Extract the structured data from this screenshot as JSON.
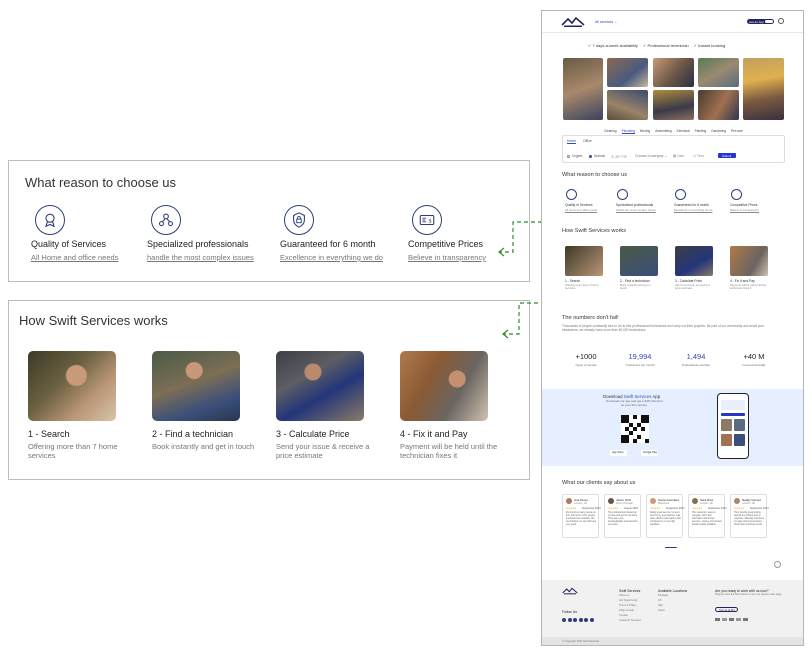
{
  "zoom_reasons": {
    "title": "What reason to choose us",
    "items": [
      {
        "title": "Quality of Services",
        "subtitle": "All Home and office needs",
        "icon": "quality-badge-icon"
      },
      {
        "title": "Specialized professionals",
        "subtitle": "handle the most complex issues",
        "icon": "professional-network-icon"
      },
      {
        "title": "Guaranteed for 6 month",
        "subtitle": "Excellence in everything we do",
        "icon": "guarantee-shield-icon"
      },
      {
        "title": "Competitive Prices",
        "subtitle": "Believe in transparency",
        "icon": "price-card-icon"
      }
    ]
  },
  "zoom_steps": {
    "title": "How Swift Services works",
    "items": [
      {
        "title": "1 - Search",
        "subtitle": "Offering more than 7 home services"
      },
      {
        "title": "2 - Find a technician",
        "subtitle": "Book instantly and get in touch"
      },
      {
        "title": "3 - Calculate Price",
        "subtitle": "Send your issue & receive a price estimate"
      },
      {
        "title": "4 - Fix it and Pay",
        "subtitle": "Payment will be held until the technician fixes it"
      }
    ]
  },
  "site": {
    "header": {
      "all_services": "All services",
      "get_app": "Get an App"
    },
    "checks": [
      "✓ 7 days-a-week availability",
      "✓ Professional technician",
      "✓ Instant booking"
    ],
    "categories": [
      "Cleaning",
      "Plumbing",
      "Moving",
      "Assembling",
      "Electrical",
      "Painting",
      "Gardening",
      "Pet care"
    ],
    "booking": {
      "tabs": [
        "Home",
        "Office"
      ],
      "urgency": [
        "Urgent",
        "Normal"
      ],
      "zip_placeholder": "ZIP PIP",
      "category_placeholder": "Choose a category",
      "date_label": "Date",
      "time_label": "Time",
      "submit": "Submit"
    },
    "reasons_title": "What reason to choose us",
    "reasons": [
      {
        "title": "Quality of Services",
        "subtitle": "All home and office needs"
      },
      {
        "title": "Specialized professionals",
        "subtitle": "handle the most complex issues"
      },
      {
        "title": "Guaranteed for 6 month",
        "subtitle": "Excellence in everything we do"
      },
      {
        "title": "Competitive Prices",
        "subtitle": "Believe in transparency"
      }
    ],
    "steps_title": "How Swift Services works",
    "steps": [
      {
        "title": "1 - Search",
        "subtitle": "Offering more than 7 home services"
      },
      {
        "title": "2 - Find a technician",
        "subtitle": "Book instantly and get in touch"
      },
      {
        "title": "3 - Calculate Price",
        "subtitle": "Send your issue & receive a price estimate"
      },
      {
        "title": "4 - Fix it and Pay",
        "subtitle": "Payment will be held until the technician fixes it"
      }
    ],
    "numbers": {
      "title": "The numbers don't fail!",
      "paragraph": "Thousands of people constantly turn to Us to hire professional technicians and carry out their projects. Be part of our community and avoid your headaches, we already have more than 60,000 technicians.",
      "stats": [
        {
          "value": "+1000",
          "label": "Types of service"
        },
        {
          "value": "19,994",
          "label": "Customers per month"
        },
        {
          "value": "1,494",
          "label": "Professional member"
        },
        {
          "value": "+40 M",
          "label": "Invoiced annually"
        }
      ]
    },
    "download": {
      "prefix": "Download",
      "brand": "Swift Services",
      "suffix": "App",
      "subtitle_1": "Download our app and get a 30% discount",
      "subtitle_2": "on your first service.",
      "app_store": "App Store",
      "google_play": "Google Play"
    },
    "testimonials_title": "What our clients say about us",
    "testimonials": [
      {
        "name": "Ana Pérez",
        "location": "London, UK",
        "date": "September 2024",
        "text": "We found so many people on this, that some of the people mentioned are fantastic. We are thankful, we can find here very good."
      },
      {
        "name": "Javier Ortiz",
        "location": "Porto, Portugal",
        "date": "August 2024",
        "text": "The professional showed up on time and got the job done. They were very knowledgeable and attended everyone."
      },
      {
        "name": "Sonia Gonzalez",
        "location": "Barcelona",
        "date": "September 2024",
        "text": "Really great service, he went beyond my expectations, was quite efficient and helpful, also completed in a very high standard."
      },
      {
        "name": "Sara Ruiz",
        "location": "London, UK",
        "date": "September 2024",
        "text": "This network is easy to navigate, with clear information about their services, pricing, and contact details readily available."
      },
      {
        "name": "Nataly Gómez",
        "location": "London, UK",
        "date": "September 2024",
        "text": "They provide great pricing without any hidden fees or surprises, allowing customers to make informed decisions about their plumbing needs."
      }
    ],
    "footer": {
      "col1_title": "Swift Services",
      "col1_links": [
        "About us",
        "Job Opportunity",
        "Terms & Policy",
        "FAQs & Help",
        "Contact",
        "Customer Services"
      ],
      "col2_title": "Available Locations",
      "col2_links": [
        "Portugal",
        "UK",
        "Italy",
        "Spain"
      ],
      "col3_title": "Are you ready to work with us now?",
      "col3_text": "Please press the blue button to see our careers web page.",
      "join_button": "Join us at Pro",
      "follow": "Follow Us",
      "copyright": "© Copyright 2024 Swift Services"
    }
  },
  "colors": {
    "accent": "#3349b8",
    "navy": "#22255e",
    "download_bg": "#e6efff",
    "arrow": "#2e8b2e"
  }
}
